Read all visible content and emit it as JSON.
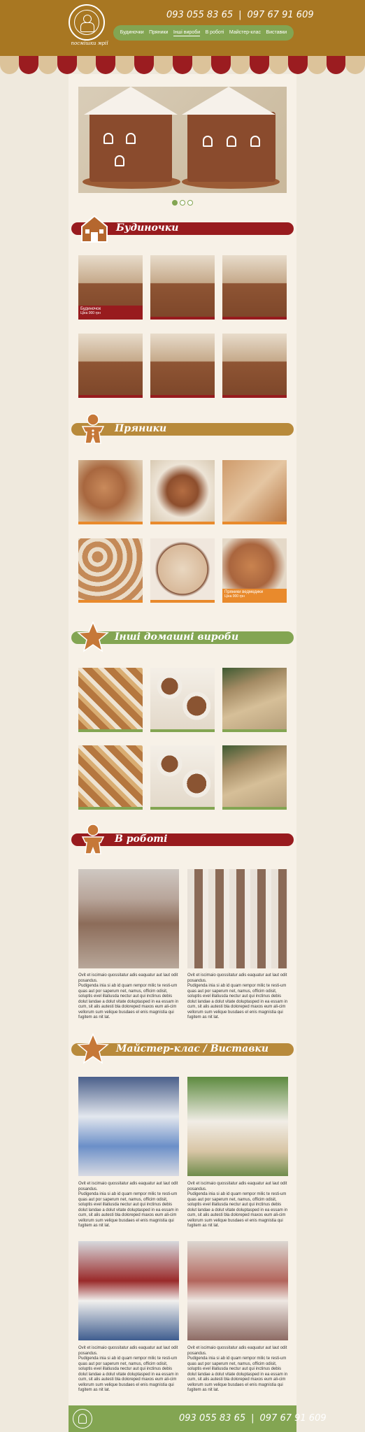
{
  "header": {
    "logo_text": "посмішки мрії",
    "phone1": "093 055 83 65",
    "separator": "|",
    "phone2": "097 67 91 609"
  },
  "nav": [
    {
      "label": "Будиночки"
    },
    {
      "label": "Пряники"
    },
    {
      "label": "Інші вироби"
    },
    {
      "label": "В роботі"
    },
    {
      "label": "Майстер-клас"
    },
    {
      "label": "Виставки"
    }
  ],
  "sections": {
    "houses": "Будиночки",
    "gingerbread": "Пряники",
    "other": "Інші домашні вироби",
    "work": "В роботі",
    "master": "Майстер-клас / Виставки"
  },
  "captions": {
    "house_name": "Будиночок",
    "house_price": "Ціна 000 грн",
    "cookie_name": "Пряники ведмедики",
    "cookie_price": "Ціна 000 грн"
  },
  "blurb": {
    "line1": "Ovit et iscimaio quossitatur adis eaquatur aut laut odit posandus.",
    "line2": "Pudigenda inia si ab id quam rempor milic te resti-um quas aut por saperum net, namus, officim odisit, soluptis evel illatiusda nectur aut qui inctinus debis dolut landae a dolut vitate doluptasped in ea essam in cum, sit alis autesti bla doloreped maxos eum ali-cim vellorum sum velique busdaes el enis magnistia qui fugitem as nit lat."
  },
  "footer": {
    "phone1": "093 055 83 65",
    "separator": "|",
    "phone2": "097 67 91 609"
  },
  "colors": {
    "brand_brown": "#a87722",
    "brand_green": "#83a552",
    "brand_red": "#981b1e",
    "accent_orange": "#e98a2c"
  },
  "slider": {
    "active_index": 0,
    "count": 3
  }
}
